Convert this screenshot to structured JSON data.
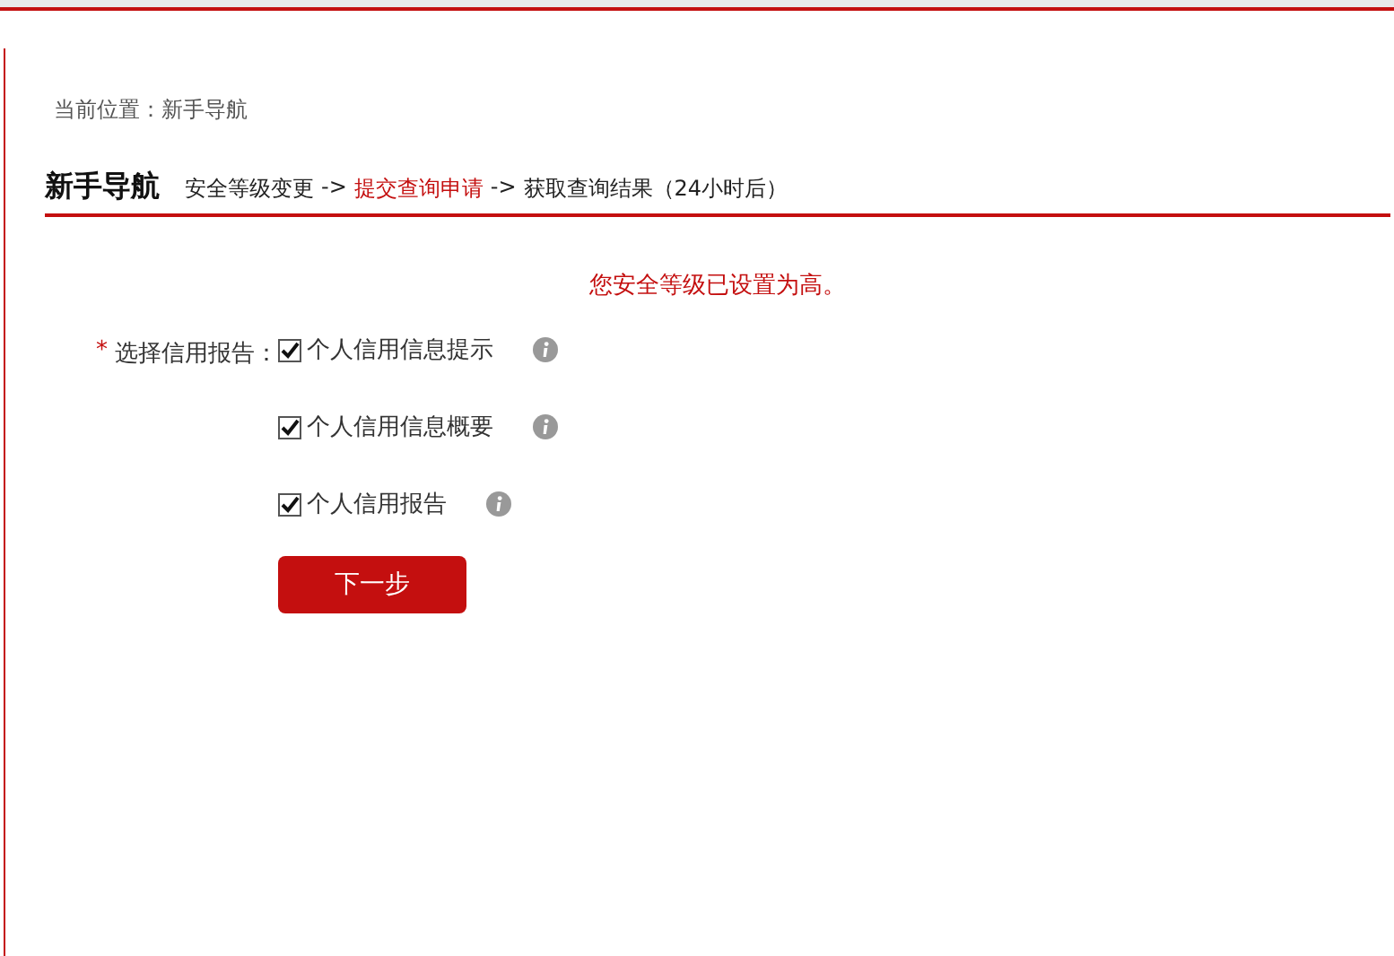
{
  "breadcrumb": {
    "label": "当前位置：",
    "current": "新手导航"
  },
  "heading": {
    "title": "新手导航",
    "steps": [
      {
        "label": "安全等级变更",
        "selected": false
      },
      {
        "label": "提交查询申请",
        "selected": true
      },
      {
        "label": "获取查询结果（24小时后）",
        "selected": false
      }
    ],
    "separators": [
      "->",
      "->"
    ]
  },
  "message": "您安全等级已设置为高。",
  "form": {
    "required_mark": "*",
    "label": "选择信用报告：",
    "options": [
      {
        "label": "个人信用信息提示",
        "checked": true
      },
      {
        "label": "个人信用信息概要",
        "checked": true
      },
      {
        "label": "个人信用报告",
        "checked": true
      }
    ]
  },
  "next_button": "下一步"
}
